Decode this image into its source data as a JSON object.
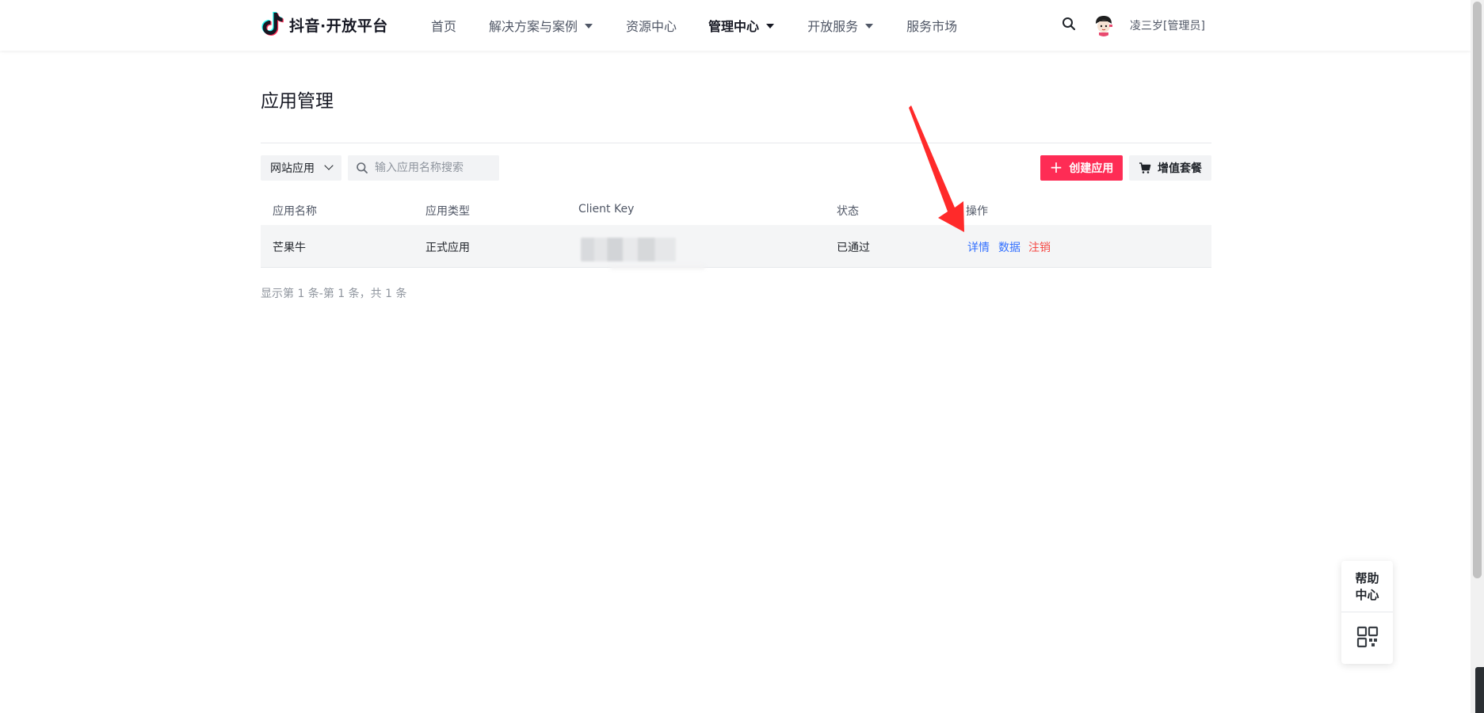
{
  "header": {
    "logo_text": "抖音·开放平台",
    "nav": [
      {
        "label": "首页",
        "dropdown": false,
        "active": false
      },
      {
        "label": "解决方案与案例",
        "dropdown": true,
        "active": false
      },
      {
        "label": "资源中心",
        "dropdown": false,
        "active": false
      },
      {
        "label": "管理中心",
        "dropdown": true,
        "active": true
      },
      {
        "label": "开放服务",
        "dropdown": true,
        "active": false
      },
      {
        "label": "服务市场",
        "dropdown": false,
        "active": false
      }
    ],
    "user_name": "凌三岁[管理员]",
    "icons": {
      "search": "search-icon",
      "avatar": "avatar"
    }
  },
  "main": {
    "title": "应用管理",
    "filter": {
      "selected": "网站应用"
    },
    "search": {
      "placeholder": "输入应用名称搜索",
      "value": ""
    },
    "create_button": "创建应用",
    "vas_button": "增值套餐",
    "table": {
      "columns": [
        "应用名称",
        "应用类型",
        "Client Key",
        "状态",
        "操作"
      ],
      "rows": [
        {
          "name": "芒果牛",
          "type": "正式应用",
          "client_key": "",
          "status": "已通过",
          "actions": [
            "详情",
            "数据",
            "注销"
          ]
        }
      ]
    },
    "pagination_info": "显示第 1 条-第 1 条，共 1 条"
  },
  "help": {
    "label_line1": "帮助",
    "label_line2": "中心"
  },
  "colors": {
    "brand": "#fe2c55",
    "link": "#3370ff",
    "danger": "#f54a45",
    "annotation": "#ff2a2a",
    "row_bg": "#f4f5f6"
  }
}
